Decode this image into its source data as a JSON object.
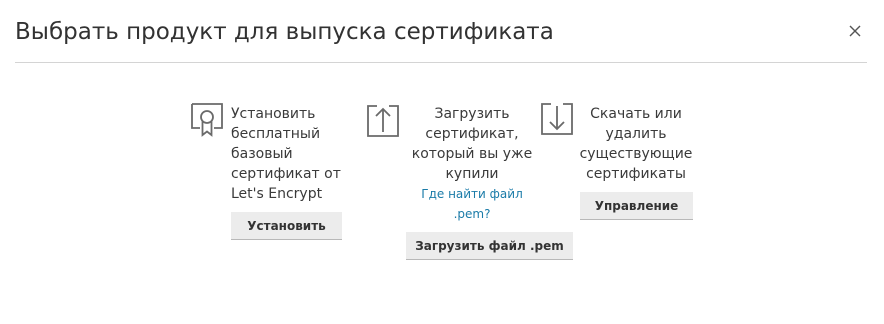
{
  "dialog": {
    "title": "Выбрать продукт для выпуска сертификата",
    "close_icon": "close-icon"
  },
  "options": [
    {
      "icon": "certificate-icon",
      "text": "Установить\nбесплатный\nбазовый\nсертификат от\nLet's Encrypt",
      "button_label": "Установить"
    },
    {
      "icon": "upload-icon",
      "text": "Загрузить\nсертификат,\nкоторый вы уже\nкупили",
      "link_text": "Где найти файл\n.pem?",
      "button_label": "Загрузить файл .pem"
    },
    {
      "icon": "download-icon",
      "text": "Скачать или\nудалить\nсуществующие\nсертификаты",
      "button_label": "Управление"
    }
  ],
  "colors": {
    "link": "#1a7ba8",
    "button_bg": "#ececec",
    "divider": "#d4d4d4"
  }
}
